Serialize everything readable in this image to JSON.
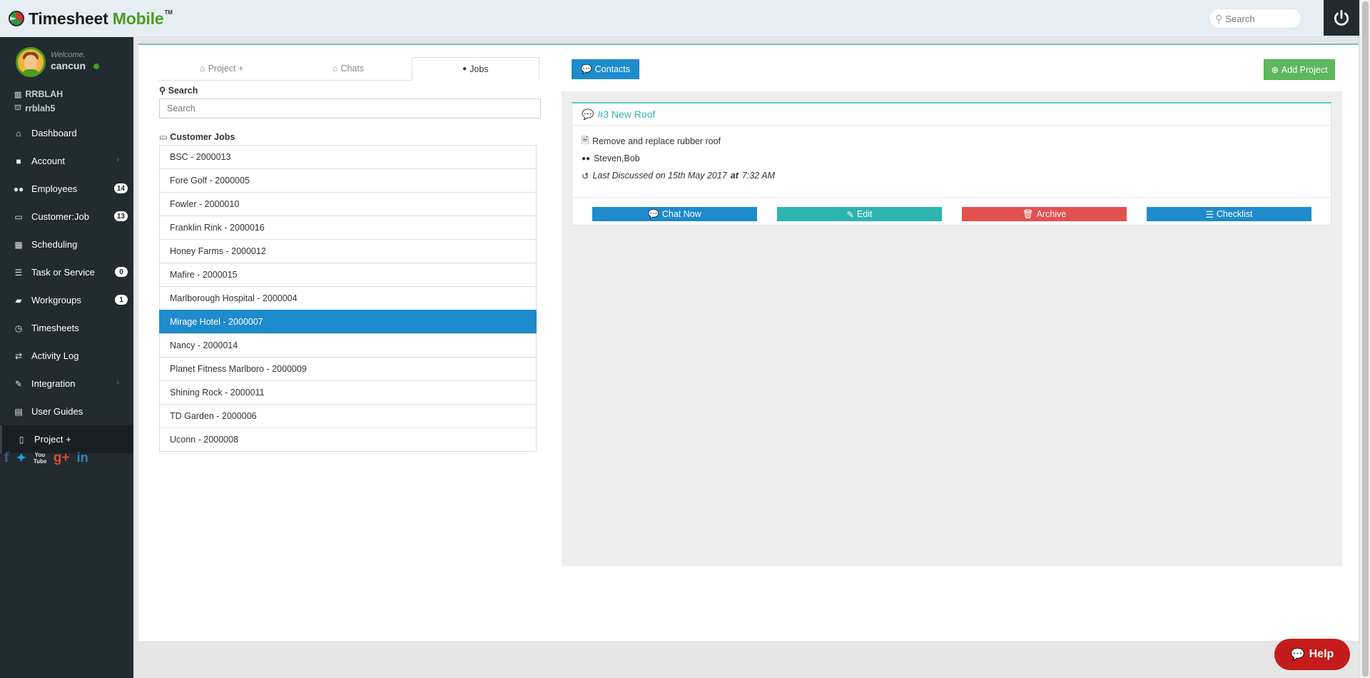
{
  "app": {
    "logo_main": "Timesheet",
    "logo_accent": "Mobile",
    "logo_tm": "TM",
    "search_placeholder": "Search",
    "power_icon": "power-icon"
  },
  "user": {
    "welcome": "Welcome,",
    "name": "cancun",
    "company": "RRBLAH",
    "account": "rrblah5"
  },
  "nav": [
    {
      "label": "Dashboard",
      "icon": "home-icon",
      "glyph": "⌂"
    },
    {
      "label": "Account",
      "icon": "lock-icon",
      "glyph": "🔒",
      "chevron": "›"
    },
    {
      "label": "Employees",
      "icon": "users-icon",
      "glyph": "👥",
      "badge": "14"
    },
    {
      "label": "Customer:Job",
      "icon": "laptop-icon",
      "glyph": "💻",
      "badge": "13"
    },
    {
      "label": "Scheduling",
      "icon": "calendar-icon",
      "glyph": "▦"
    },
    {
      "label": "Task or Service",
      "icon": "list-icon",
      "glyph": "☰",
      "badge": "0"
    },
    {
      "label": "Workgroups",
      "icon": "folder-icon",
      "glyph": "📂",
      "badge": "1"
    },
    {
      "label": "Timesheets",
      "icon": "clock-icon",
      "glyph": "◷"
    },
    {
      "label": "Activity Log",
      "icon": "exchange-icon",
      "glyph": "⇄"
    },
    {
      "label": "Integration",
      "icon": "plug-icon",
      "glyph": "✎",
      "chevron": "›"
    },
    {
      "label": "User Guides",
      "icon": "book-icon",
      "glyph": "📖"
    },
    {
      "label": "Project +",
      "icon": "file-icon",
      "glyph": "🗎"
    }
  ],
  "social": {
    "facebook": "f",
    "twitter": "🐦",
    "youtube": "You Tube",
    "googleplus": "g+",
    "linkedin": "in"
  },
  "tabs": [
    {
      "label": "Project +",
      "glyph": "⌂"
    },
    {
      "label": "Chats",
      "glyph": "⌂"
    },
    {
      "label": "Jobs",
      "glyph": "👤"
    }
  ],
  "search": {
    "label": "Search",
    "placeholder": "Search"
  },
  "jobs": {
    "label": "Customer Jobs",
    "items": [
      "BSC - 2000013",
      "Fore Golf - 2000005",
      "Fowler - 2000010",
      "Franklin Rink - 2000016",
      "Honey Farms - 2000012",
      "Mafire - 2000015",
      "Marlborough Hospital - 2000004",
      "Mirage Hotel - 2000007",
      "Nancy - 2000014",
      "Planet Fitness Marlboro - 2000009",
      "Shining Rock - 2000011",
      "TD Garden - 2000006",
      "Uconn - 2000008"
    ],
    "selected": "Mirage Hotel - 2000007"
  },
  "buttons": {
    "contacts": "Contacts",
    "add_project": "Add Project"
  },
  "project": {
    "title": "#3 New Roof",
    "description": "Remove and replace rubber roof",
    "members": "Steven,Bob",
    "last_discussed_prefix": "Last Discussed on 15th May 2017",
    "at": "at",
    "time": "7:32 AM",
    "actions": {
      "chat": "Chat Now",
      "edit": "Edit",
      "archive": "Archive",
      "checklist": "Checklist"
    }
  },
  "help": {
    "label": "Help"
  },
  "colors": {
    "accent_blue": "#1e8bcd",
    "teal": "#2cb4b0",
    "red": "#e35050",
    "green": "#5cb85c",
    "sidebar": "#222b2f",
    "help": "#c41b1b"
  }
}
